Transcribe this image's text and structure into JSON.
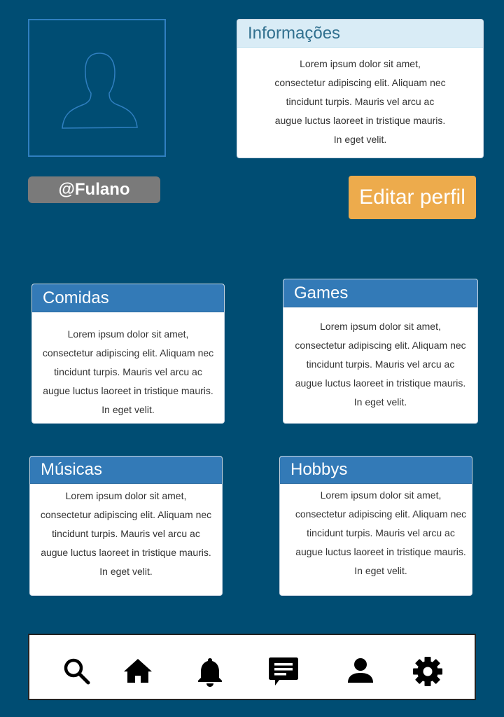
{
  "profile": {
    "username": "@Fulano",
    "edit_button": "Editar perfil"
  },
  "info_panel": {
    "title": "Informações",
    "lines": [
      "Lorem ipsum dolor sit amet,",
      "consectetur adipiscing elit. Aliquam nec",
      "tincidunt turpis. Mauris vel arcu ac",
      "augue luctus laoreet in tristique mauris.",
      "In eget velit."
    ]
  },
  "panels": [
    {
      "title": "Comidas",
      "lines": [
        "Lorem ipsum dolor sit amet,",
        "consectetur adipiscing elit. Aliquam nec",
        "tincidunt turpis. Mauris vel arcu ac",
        "augue luctus laoreet in tristique mauris.",
        "In eget velit."
      ]
    },
    {
      "title": "Games",
      "lines": [
        "Lorem ipsum dolor sit amet,",
        "consectetur adipiscing elit. Aliquam nec",
        "tincidunt turpis. Mauris vel arcu ac",
        "augue luctus laoreet in tristique mauris.",
        "In eget velit."
      ]
    },
    {
      "title": "Músicas",
      "lines": [
        "Lorem ipsum dolor sit amet,",
        "consectetur adipiscing elit. Aliquam nec",
        "tincidunt turpis. Mauris vel arcu ac",
        "augue luctus laoreet in tristique mauris.",
        "In eget velit."
      ]
    },
    {
      "title": "Hobbys",
      "lines": [
        "Lorem ipsum dolor sit amet,",
        "consectetur adipiscing elit. Aliquam nec",
        "tincidunt turpis. Mauris vel arcu ac",
        "augue luctus laoreet in tristique mauris.",
        "In eget velit."
      ]
    }
  ],
  "nav": [
    "search-icon",
    "home-icon",
    "bell-icon",
    "chat-icon",
    "user-icon",
    "gear-icon"
  ],
  "colors": {
    "background": "#004d73",
    "panel_header": "#337ab7",
    "info_header": "#d9ecf6",
    "edit_button": "#edab4c",
    "username_badge": "#7a7a7a"
  }
}
